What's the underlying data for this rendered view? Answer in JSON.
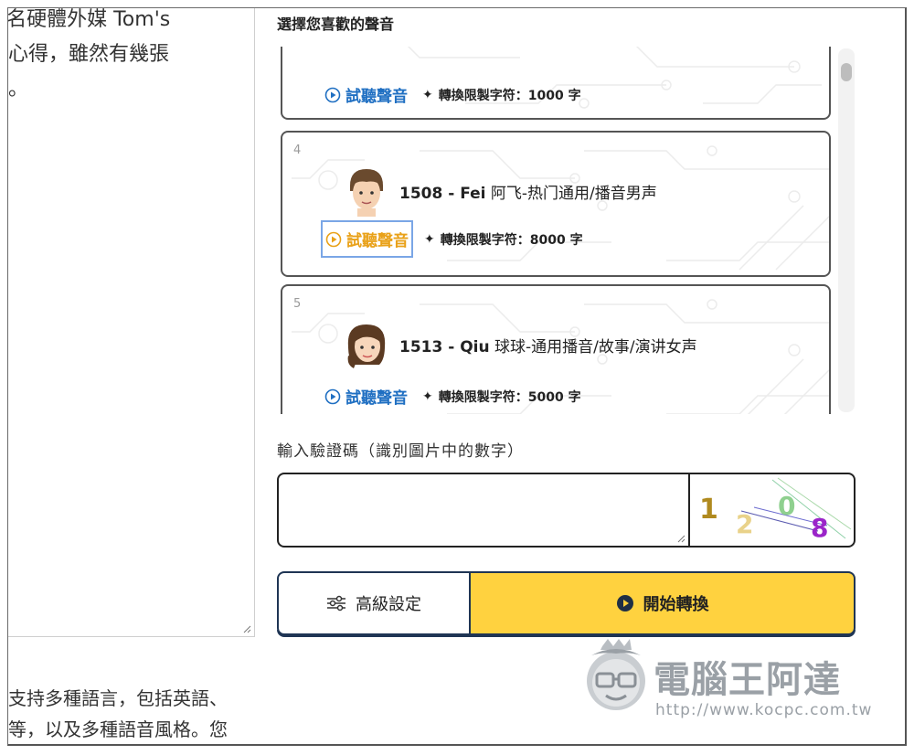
{
  "article": {
    "top_lines": [
      "l名硬體外媒 Tom's",
      "心得，雖然有幾張",
      "。"
    ],
    "bottom_lines": [
      "支持多種語言，包括英語、",
      "等，以及多種語音風格。您"
    ]
  },
  "voice_section": {
    "title": "選擇您喜歡的聲音",
    "cards": [
      {
        "number": "",
        "name_code": "",
        "name_desc": "",
        "listen_label": "試聽聲音",
        "limit_label": "轉換限製字符：1000 字"
      },
      {
        "number": "4",
        "name_code": "1508 - Fei",
        "name_desc": "阿飞-热门通用/播音男声",
        "listen_label": "試聽聲音",
        "limit_label": "轉換限製字符：8000 字"
      },
      {
        "number": "5",
        "name_code": "1513 - Qiu",
        "name_desc": "球球-通用播音/故事/演讲女声",
        "listen_label": "試聽聲音",
        "limit_label": "轉換限製字符：5000 字"
      }
    ]
  },
  "captcha": {
    "label": "輸入驗證碼（識別圖片中的數字）",
    "input_value": "",
    "digits": [
      "1",
      "2",
      "0",
      "8"
    ],
    "digit_colors": [
      "#b08a1f",
      "#e9d28a",
      "#8fd08f",
      "#9b25c9"
    ]
  },
  "actions": {
    "advanced_label": "高級設定",
    "start_label": "開始轉換"
  },
  "watermark": {
    "title": "電腦王阿達",
    "url": "http://www.kocpc.com.tw"
  },
  "colors": {
    "accent_yellow": "#ffd23f",
    "navy": "#1f3554",
    "link_blue": "#1f6fc2",
    "active_orange": "#e9a118"
  }
}
